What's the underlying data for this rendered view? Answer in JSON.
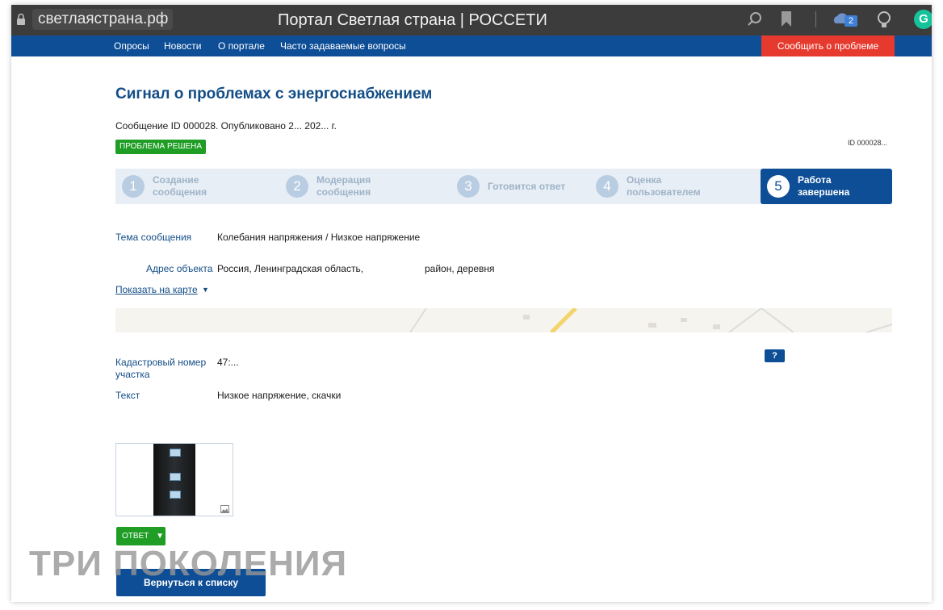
{
  "browser": {
    "url": "светлаястрана.рф",
    "title": "Портал Светлая страна | РОССЕТИ",
    "badge_count": "2",
    "extension_letter": "G"
  },
  "nav": {
    "items": [
      "Опросы",
      "Новости",
      "О портале",
      "Часто задаваемые вопросы"
    ],
    "report_button": "Сообщить о проблеме"
  },
  "page": {
    "title": "Сигнал о проблемах с энергоснабжением",
    "message_line": "Сообщение ID 000028. Опубликовано 2... 202... г.",
    "status": "ПРОБЛЕМА РЕШЕНА",
    "id_right": "ID 000028..."
  },
  "steps": [
    {
      "num": "1",
      "label": "Создание сообщения"
    },
    {
      "num": "2",
      "label": "Модерация сообщения"
    },
    {
      "num": "3",
      "label": "Готовится ответ"
    },
    {
      "num": "4",
      "label": "Оценка пользователем"
    },
    {
      "num": "5",
      "label": "Работа завершена"
    }
  ],
  "fields": {
    "topic_label": "Тема сообщения",
    "topic_value": "Колебания напряжения / Низкое напряжение",
    "address_label": "Адрес объекта",
    "address_value": "Россия, Ленинградская область,",
    "address_value_tail": "район, деревня",
    "map_link": "Показать на карте",
    "cadastral_label_1": "Кадастровый номер",
    "cadastral_label_2": "участка",
    "cadastral_value": "47:...",
    "text_label": "Текст",
    "text_value": "Низкое напряжение, скачки",
    "help": "?"
  },
  "actions": {
    "answer": "ОТВЕТ",
    "back": "Вернуться к списку"
  },
  "watermark": "ТРИ ПОКОЛЕНИЯ",
  "colors": {
    "primary": "#0e4e96",
    "danger": "#e63a2e",
    "success": "#1f9d24"
  }
}
